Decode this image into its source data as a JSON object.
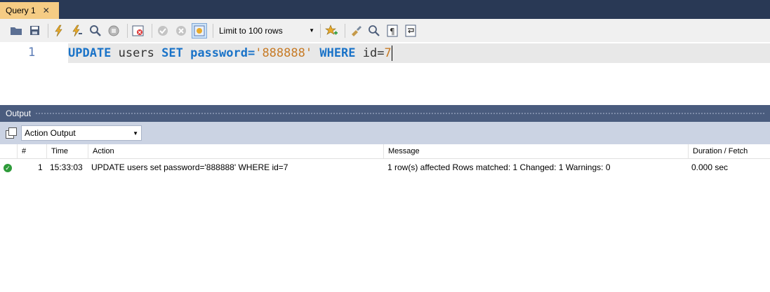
{
  "tab": {
    "title": "Query 1",
    "close": "✕"
  },
  "toolbar": {
    "limit_label": "Limit to 100 rows"
  },
  "editor": {
    "line_number": "1",
    "tokens": {
      "kw_update": "UPDATE",
      "ident_users": "users",
      "kw_set": "SET",
      "ident_password": "password=",
      "str_value": "'888888'",
      "kw_where": "WHERE",
      "ident_id": "id=",
      "num_value": "7"
    }
  },
  "output": {
    "title": "Output",
    "selector_value": "Action Output",
    "columns": {
      "num": "#",
      "time": "Time",
      "action": "Action",
      "message": "Message",
      "duration": "Duration / Fetch"
    },
    "rows": [
      {
        "num": "1",
        "time": "15:33:03",
        "action": "UPDATE users set password='888888' WHERE id=7",
        "message": "1 row(s) affected Rows matched: 1  Changed: 1  Warnings: 0",
        "duration": "0.000 sec",
        "status_icon": "check-circle-icon"
      }
    ]
  },
  "colors": {
    "tab_active": "#f5cc84",
    "header_bar": "#293955",
    "output_header": "#4a5c7e",
    "success": "#2e9b3a",
    "keyword": "#1a73c8",
    "string": "#c77b26"
  }
}
